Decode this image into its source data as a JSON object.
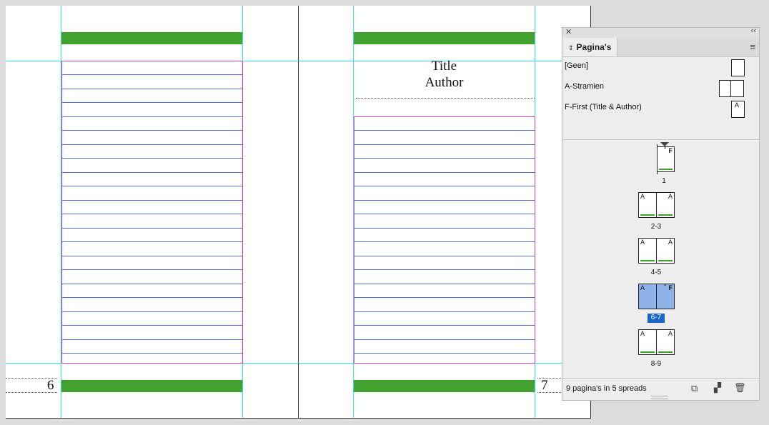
{
  "document": {
    "left_page_number": "6",
    "right_page_number": "7",
    "title_text": "Title",
    "author_text": "Author",
    "colors": {
      "guide": "#33e0e0",
      "accent_bar": "#43a22f",
      "frame": "#d040c0",
      "baseline": "#4f6fd6"
    }
  },
  "panel": {
    "tab_label": "Pagina's",
    "close_icon": "close-icon",
    "collapse_icon": "double-chevron-icon",
    "menu_icon": "hamburger-menu-icon",
    "masters": [
      {
        "label": "[Geen]"
      },
      {
        "label": "A-Stramien"
      },
      {
        "label": "F-First (Title & Author)",
        "thumb_letter": "A"
      }
    ],
    "spreads": [
      {
        "label": "1",
        "left_letter": "",
        "right_letter": "F",
        "selected": false
      },
      {
        "label": "2-3",
        "left_letter": "A",
        "right_letter": "A",
        "selected": false
      },
      {
        "label": "4-5",
        "left_letter": "A",
        "right_letter": "A",
        "selected": false
      },
      {
        "label": "6-7",
        "left_letter": "A",
        "right_letter": "F",
        "selected": true
      },
      {
        "label": "8-9",
        "left_letter": "A",
        "right_letter": "A",
        "selected": false
      }
    ],
    "status_text": "9 pagina's in 5 spreads",
    "status_icons": [
      "edit-page-size-icon",
      "new-page-icon",
      "trash-icon"
    ]
  }
}
